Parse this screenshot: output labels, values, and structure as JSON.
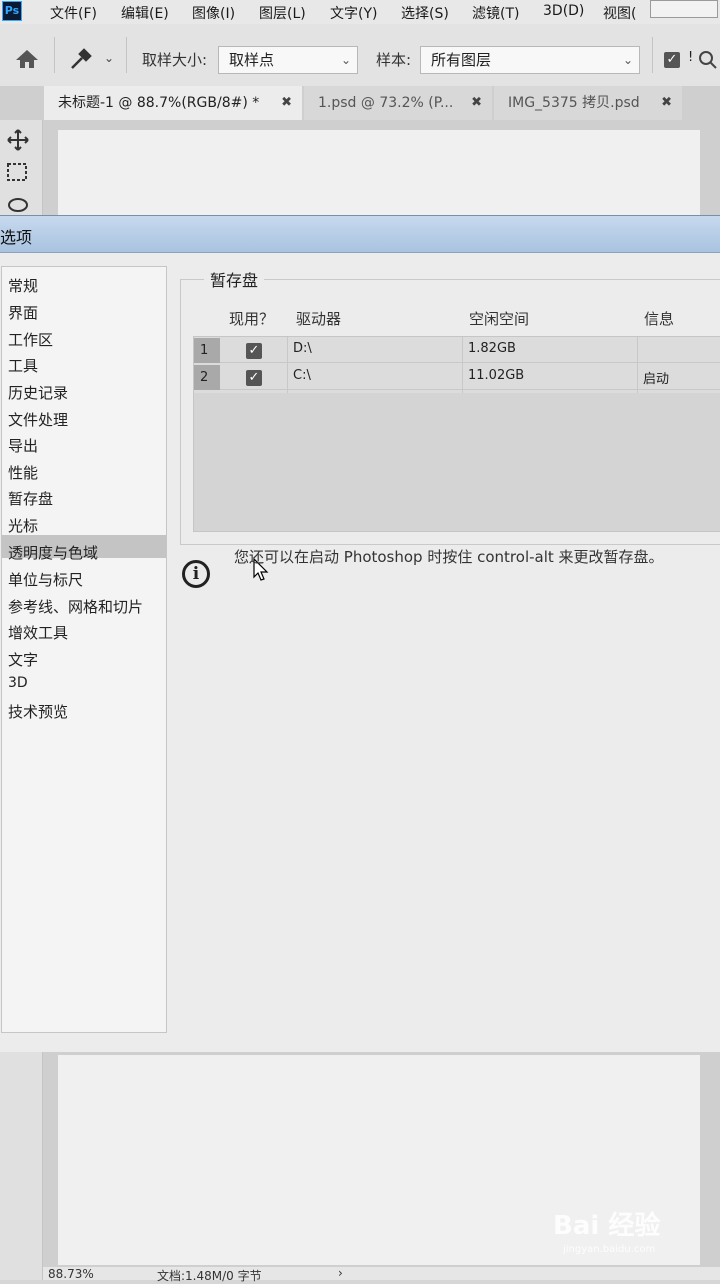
{
  "app": {
    "logo": "Ps"
  },
  "menubar": {
    "items": [
      "文件(F)",
      "编辑(E)",
      "图像(I)",
      "图层(L)",
      "文字(Y)",
      "选择(S)",
      "滤镜(T)",
      "3D(D)",
      "视图("
    ]
  },
  "options": {
    "sample_size_label": "取样大小:",
    "sample_size_value": "取样点",
    "sample_label": "样本:",
    "sample_value": "所有图层",
    "checkbox_label": "!"
  },
  "tabs": [
    {
      "label": "未标题-1 @ 88.7%(RGB/8#) *"
    },
    {
      "label": "1.psd @ 73.2% (P..."
    },
    {
      "label": "IMG_5375 拷贝.psd"
    }
  ],
  "dialog": {
    "title": "选项",
    "sidebar": [
      "常规",
      "界面",
      "工作区",
      "工具",
      "历史记录",
      "文件处理",
      "导出",
      "性能",
      "暂存盘",
      "光标",
      "透明度与色域",
      "单位与标尺",
      "参考线、网格和切片",
      "增效工具",
      "文字",
      "3D",
      "技术预览"
    ],
    "selected": "暂存盘",
    "group_title": "暂存盘",
    "columns": [
      "现用？",
      "驱动器",
      "空闲空间",
      "信息"
    ],
    "rows": [
      {
        "num": "1",
        "drive": "D:\\",
        "free": "1.82GB",
        "info": "",
        "active": true
      },
      {
        "num": "2",
        "drive": "C:\\",
        "free": "11.02GB",
        "info": "启动",
        "active": true
      }
    ],
    "hint": "您还可以在启动 Photoshop 时按住 control-alt 来更改暂存盘。"
  },
  "status": {
    "zoom": "88.73%",
    "doc": "文档:1.48M/0 字节"
  },
  "watermark": {
    "brand": "Bai 经验",
    "url": "jingyan.baidu.com"
  }
}
